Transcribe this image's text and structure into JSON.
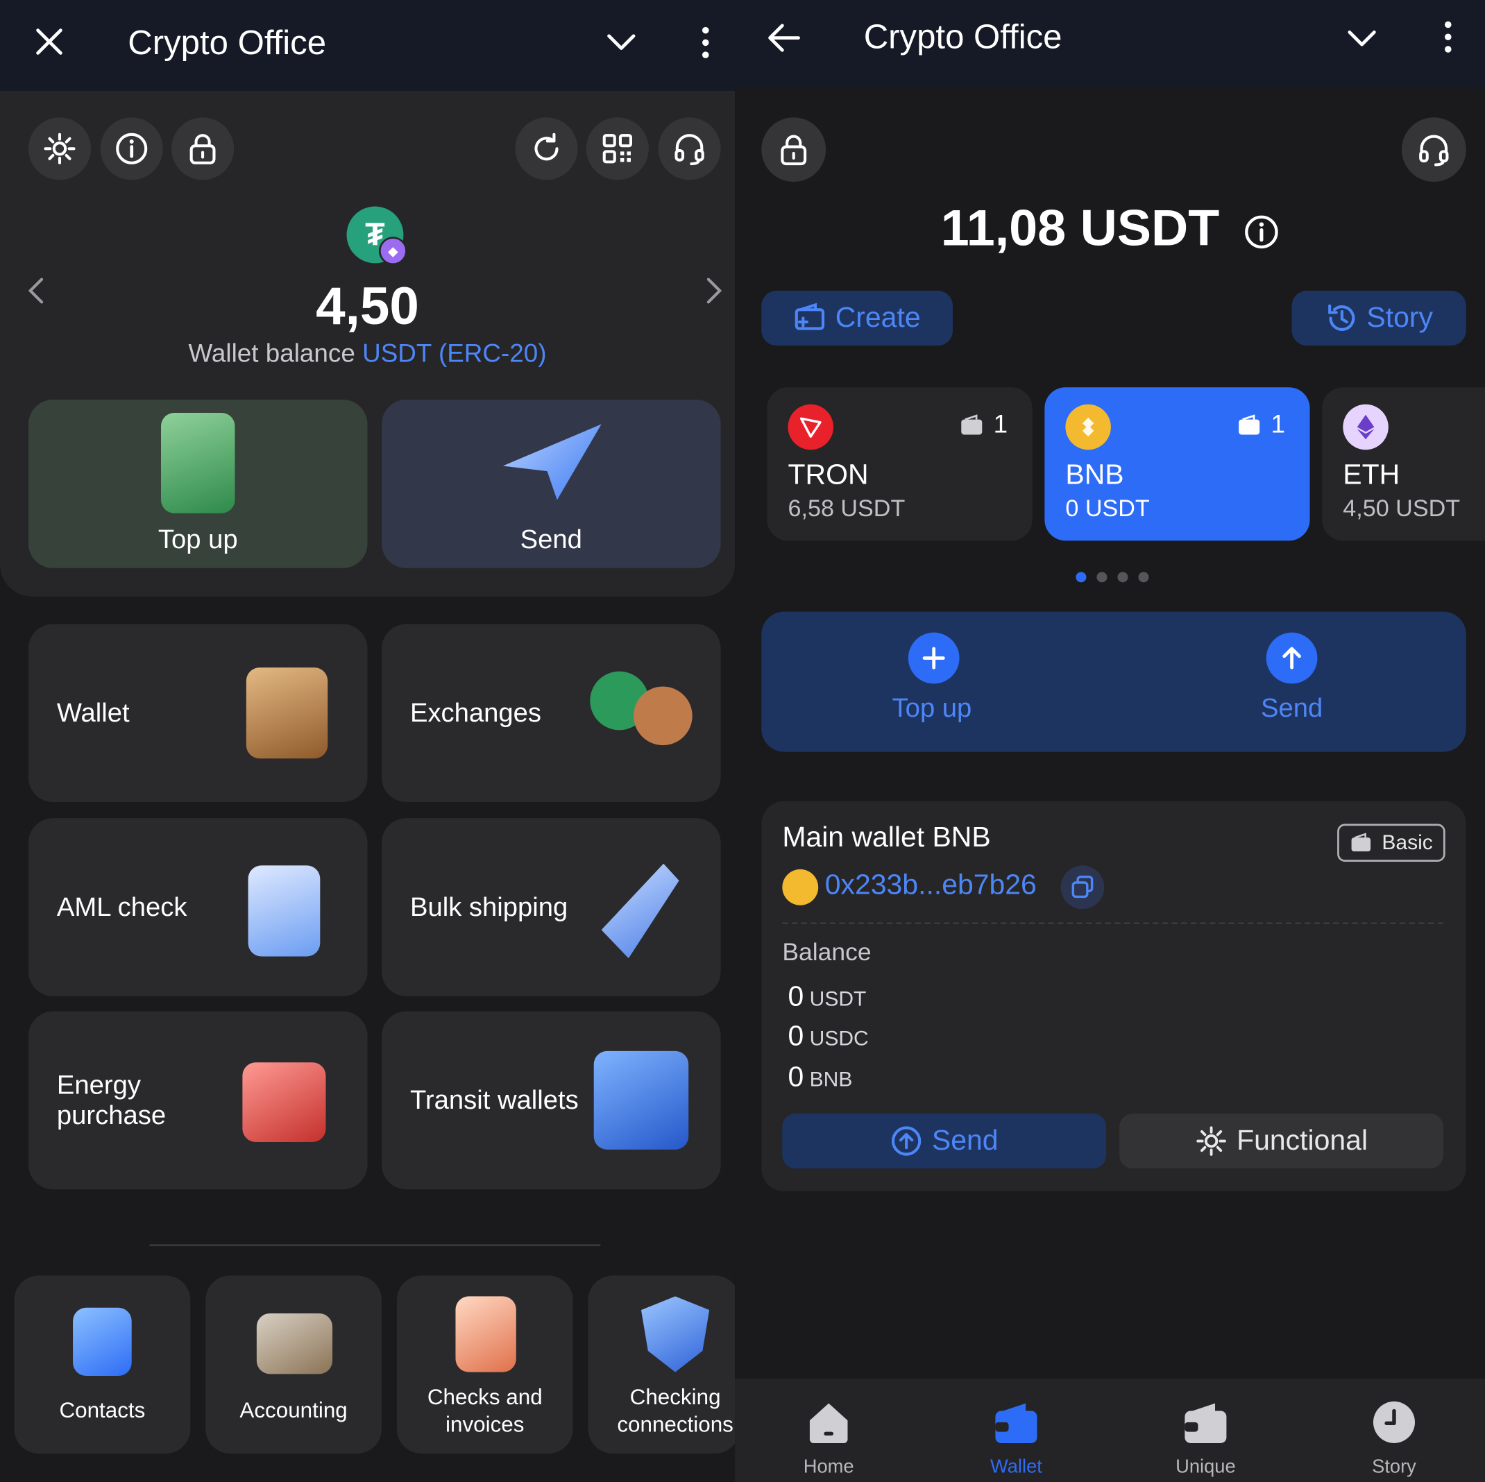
{
  "left": {
    "header": {
      "title": "Crypto Office"
    },
    "balance": {
      "amount": "4,50",
      "label": "Wallet balance",
      "asset": "USDT (ERC-20)"
    },
    "primary": {
      "topup_label": "Top up",
      "send_label": "Send"
    },
    "tiles": [
      {
        "label": "Wallet"
      },
      {
        "label": "Exchanges"
      },
      {
        "label": "AML check"
      },
      {
        "label": "Bulk shipping"
      },
      {
        "label": "Energy purchase"
      },
      {
        "label": "Transit wallets"
      }
    ],
    "bottom_tiles": [
      {
        "label": "Contacts"
      },
      {
        "label": "Accounting"
      },
      {
        "label": "Checks and invoices"
      },
      {
        "label": "Checking connections"
      }
    ]
  },
  "right": {
    "header": {
      "title": "Crypto Office"
    },
    "total": {
      "amount": "11,08 USDT"
    },
    "create_label": "Create",
    "story_label": "Story",
    "networks": [
      {
        "name": "TRON",
        "balance": "6,58 USDT",
        "count": "1"
      },
      {
        "name": "BNB",
        "balance": "0 USDT",
        "count": "1"
      },
      {
        "name": "ETH",
        "balance": "4,50 USDT"
      }
    ],
    "actions": {
      "topup_label": "Top up",
      "send_label": "Send"
    },
    "wallet": {
      "title": "Main wallet BNB",
      "badge": "Basic",
      "address": "0x233b...eb7b26",
      "balance_label": "Balance",
      "balances": [
        {
          "amount": "0",
          "unit": "USDT"
        },
        {
          "amount": "0",
          "unit": "USDC"
        },
        {
          "amount": "0",
          "unit": "BNB"
        }
      ],
      "send_label": "Send",
      "functional_label": "Functional"
    },
    "nav": [
      {
        "label": "Home"
      },
      {
        "label": "Wallet"
      },
      {
        "label": "Unique"
      },
      {
        "label": "Story"
      }
    ]
  },
  "colors": {
    "accent": "#2d6cf6",
    "link": "#4d86f7",
    "header_bg": "#151a26",
    "panel_bg": "#262628"
  }
}
